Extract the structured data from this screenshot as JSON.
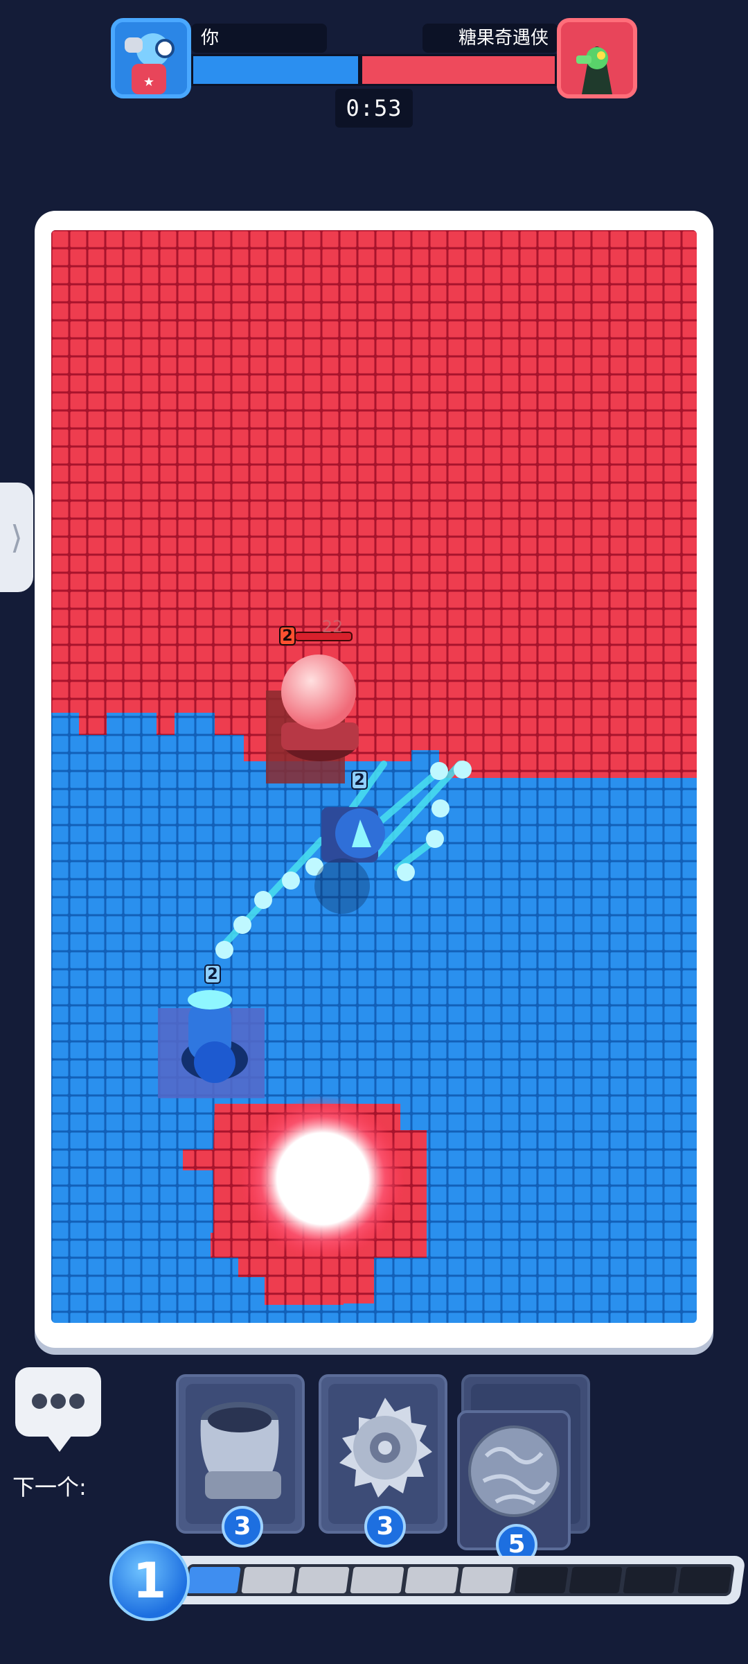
{
  "header": {
    "player_name": "你",
    "opponent_name": "糖果奇遇侠",
    "timer": "0:53"
  },
  "board": {
    "enemy_tower_level": "2",
    "enemy_tower_hp": "22",
    "mech_level": "2",
    "cannon_level": "2"
  },
  "chat": {
    "next_label": "下一个:"
  },
  "cards": [
    {
      "name": "mortar-card",
      "icon": "mortar-icon",
      "cost": "3"
    },
    {
      "name": "saw-card",
      "icon": "saw-blade-icon",
      "cost": "3"
    },
    {
      "name": "boulder-card",
      "icon": "boulder-icon",
      "cost": "5"
    }
  ],
  "elixir": {
    "count": "1",
    "segments_total": 10,
    "segments_filled": 6
  },
  "colors": {
    "player": "#2b8ff0",
    "opponent": "#ee4a5c",
    "background": "#141c38"
  }
}
